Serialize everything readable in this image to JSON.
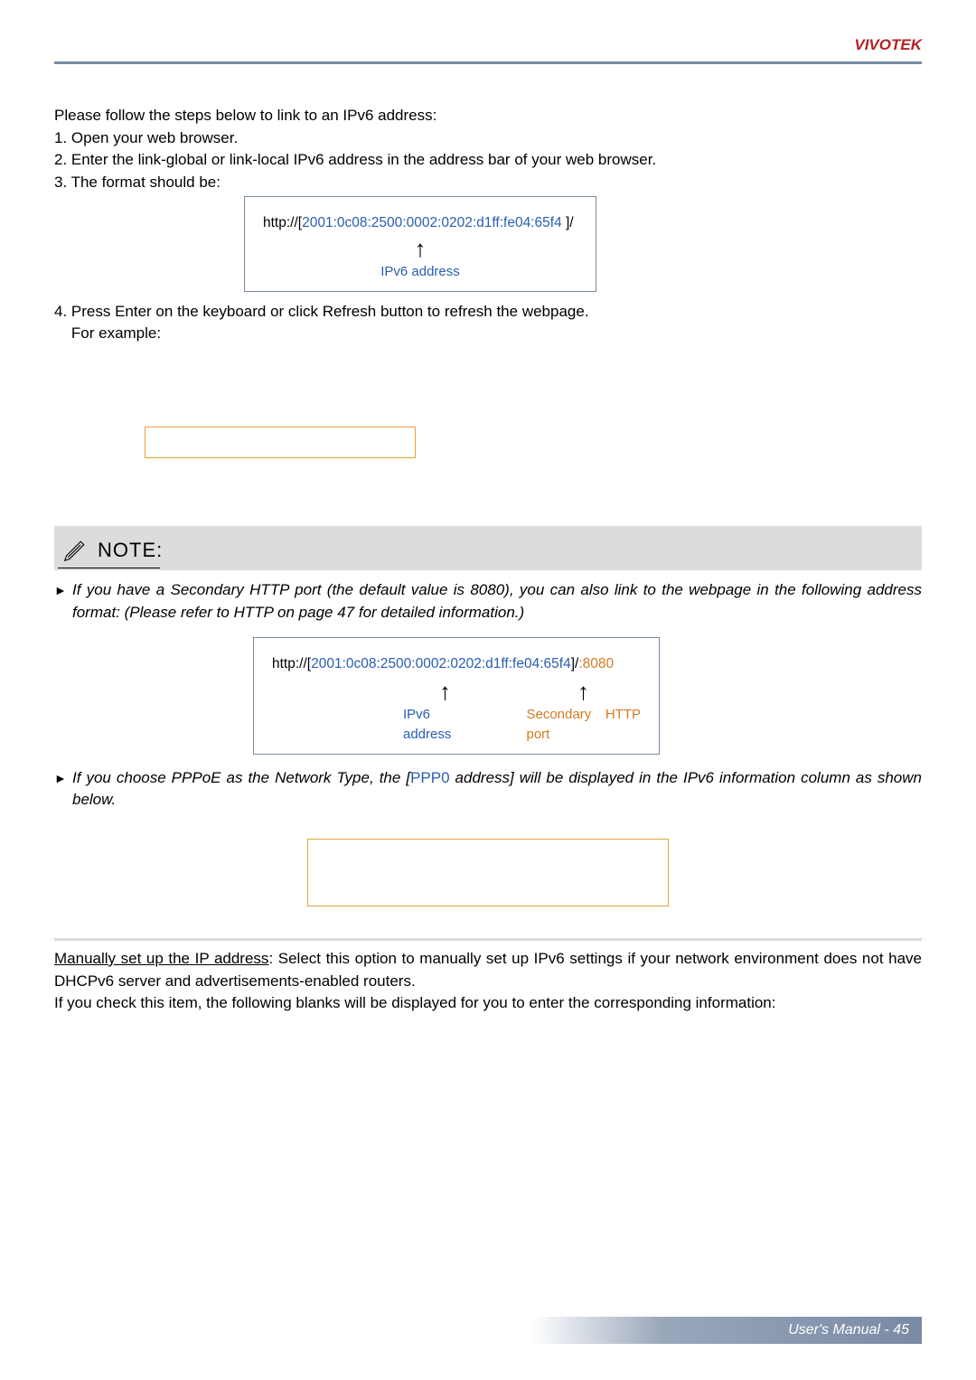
{
  "header": {
    "brand": "VIVOTEK"
  },
  "intro": "Please follow the steps below to link to an IPv6 address:",
  "steps": {
    "s1": "1. Open your web browser.",
    "s2": "2. Enter the link-global or link-local IPv6 address in the address bar of your web browser.",
    "s3": "3. The format should be:"
  },
  "format1": {
    "prefix": "http://[",
    "addr": "2001:0c08:2500:0002:0202:d1ff:fe04:65f4",
    "suffix": "   ]/",
    "label": "IPv6 address"
  },
  "step4": {
    "line1": "4. Press Enter on the keyboard or click Refresh button to refresh the webpage.",
    "line2": "    For example:"
  },
  "note": {
    "title": "NOTE:",
    "item1a": "If you have a Secondary HTTP port (the default value is 8080), you can also link to the webpage in the following address format: (Please refer to HTTP on page 47 for detailed information.)",
    "item2a": "If you choose PPPoE as the Network Type, the [",
    "ppp0": "PPP0",
    "item2b": " address] will be displayed in the IPv6 information column as shown below."
  },
  "format2": {
    "prefix": "http://[",
    "addr": "2001:0c08:2500:0002:0202:d1ff:fe04:65f4",
    "mid": "]/",
    "port": ":8080",
    "label1": "IPv6 address",
    "label2": "Secondary HTTP port"
  },
  "manual": {
    "heading": "Manually set up the IP address",
    "rest": ": Select this option to manually set up IPv6 settings if your network environment does not have DHCPv6 server and advertisements-enabled routers.",
    "line2": "If you check this item, the following blanks will be displayed for you to enter the corresponding information:"
  },
  "footer": {
    "text": "User's Manual - 45"
  }
}
